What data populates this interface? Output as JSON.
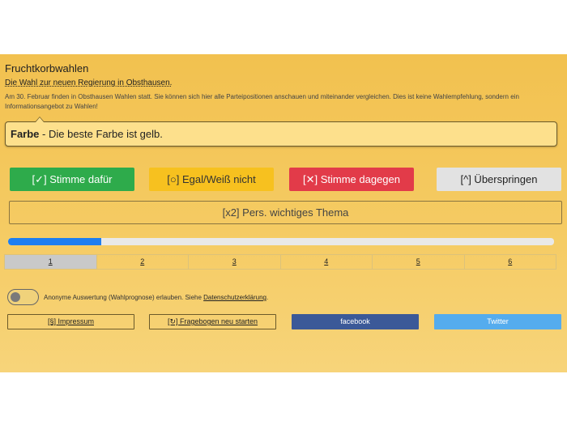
{
  "header": {
    "title": "Fruchtkorbwahlen",
    "subtitle": "Die Wahl zur neuen Regierung in Obsthausen.",
    "intro": "Am 30. Februar finden in Obsthausen Wahlen statt. Sie können sich hier alle Parteipositionen anschauen und miteinander vergleichen. Dies ist keine Wahlempfehlung, sondern ein Informationsangebot zu Wahlen!"
  },
  "thesis": {
    "topic": "Farbe",
    "separator": " - ",
    "text": "Die beste Farbe ist gelb."
  },
  "votes": {
    "yes": "[✓] Stimme dafür",
    "neutral": "[○] Egal/Weiß nicht",
    "no": "[✕] Stimme dagegen",
    "skip": "[^] Überspringen",
    "important": "[x2] Pers. wichtiges Thema"
  },
  "progress": {
    "fraction": 0.17
  },
  "pager": {
    "items": [
      "1",
      "2",
      "3",
      "4",
      "5",
      "6"
    ],
    "active_index": 0
  },
  "consent": {
    "text": "Anonyme Auswertung (Wahlprognose) erlauben. Siehe ",
    "link": "Datenschutzerklärung",
    "suffix": ".",
    "enabled": false
  },
  "footer": {
    "impressum": "[§] Impressum",
    "restart": "[↻] Fragebogen neu starten",
    "facebook": "facebook",
    "twitter": "Twitter"
  },
  "colors": {
    "background": "#f5cb63",
    "yes": "#2eab4b",
    "neutral": "#f7c11f",
    "no": "#e23b49",
    "skip": "#e2e2e2",
    "progress": "#1e7ef0",
    "facebook": "#3b5998",
    "twitter": "#55acee"
  }
}
